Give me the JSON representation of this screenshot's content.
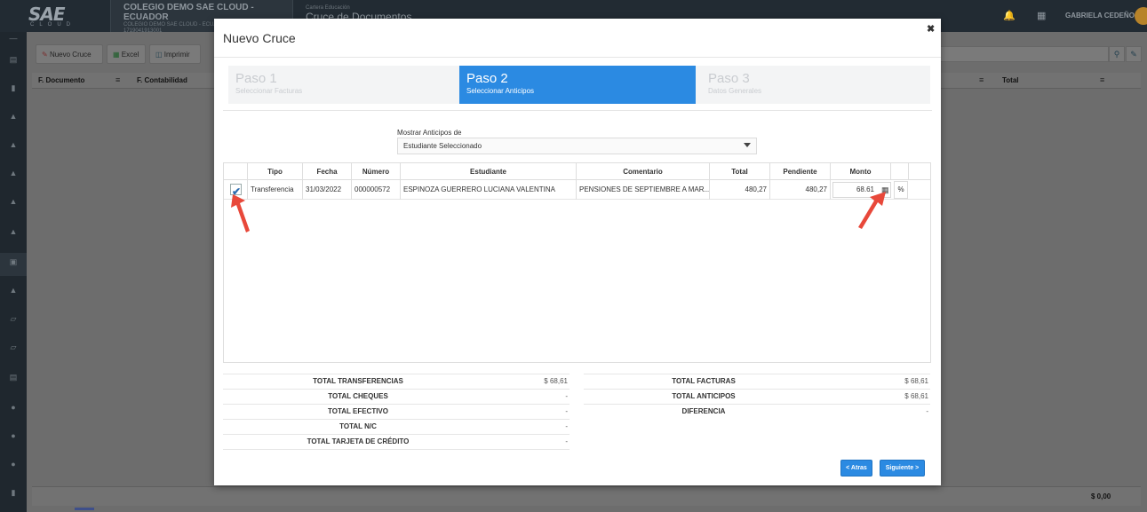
{
  "app": {
    "logo_text": "SAE",
    "logo_sub": "CLOUD",
    "school_name": "COLEGIO DEMO SAE CLOUD - ECUADOR",
    "school_sub1": "COLEGIO DEMO SAE CLOUD - ECUADOR",
    "school_sub2": "1719041913001",
    "module_label": "Cartera Educación",
    "module_title": "Cruce de Documentos",
    "user_name": "GABRIELA CEDEÑO"
  },
  "toolbar": {
    "new_label": "Nuevo Cruce",
    "excel_label": "Excel",
    "print_label": "Imprimir"
  },
  "grid": {
    "col_doc": "F. Documento",
    "col_cont": "F. Contabilidad",
    "col_total": "Total",
    "footer_total": "$ 0,00"
  },
  "modal": {
    "title": "Nuevo Cruce",
    "steps": [
      {
        "title": "Paso 1",
        "subtitle": "Seleccionar Facturas"
      },
      {
        "title": "Paso 2",
        "subtitle": "Seleccionar Anticipos"
      },
      {
        "title": "Paso 3",
        "subtitle": "Datos Generales"
      }
    ],
    "mostrar_label": "Mostrar Anticipos de",
    "mostrar_value": "Estudiante Seleccionado",
    "table": {
      "headers": [
        "Tipo",
        "Fecha",
        "Número",
        "Estudiante",
        "Comentario",
        "Total",
        "Pendiente",
        "Monto"
      ],
      "row": {
        "tipo": "Transferencia",
        "fecha": "31/03/2022",
        "numero": "000000572",
        "estudiante": "ESPINOZA GUERRERO LUCIANA VALENTINA",
        "comentario": "PENSIONES DE SEPTIEMBRE A MAR...",
        "total": "480,27",
        "pendiente": "480,27",
        "monto": "68.61",
        "pct": "%"
      }
    },
    "summary_left": [
      {
        "label": "TOTAL TRANSFERENCIAS",
        "value": "$ 68,61"
      },
      {
        "label": "TOTAL CHEQUES",
        "value": "-"
      },
      {
        "label": "TOTAL EFECTIVO",
        "value": "-"
      },
      {
        "label": "TOTAL N/C",
        "value": "-"
      },
      {
        "label": "TOTAL TARJETA DE CRÉDITO",
        "value": "-"
      }
    ],
    "summary_right": [
      {
        "label": "TOTAL FACTURAS",
        "value": "$ 68,61"
      },
      {
        "label": "TOTAL ANTICIPOS",
        "value": "$ 68,61"
      },
      {
        "label": "DIFERENCIA",
        "value": "-"
      }
    ],
    "btn_back": "< Atras",
    "btn_next": "Siguiente >"
  },
  "colors": {
    "accent": "#2b8ae2",
    "annotation_arrow": "#e8483a"
  }
}
